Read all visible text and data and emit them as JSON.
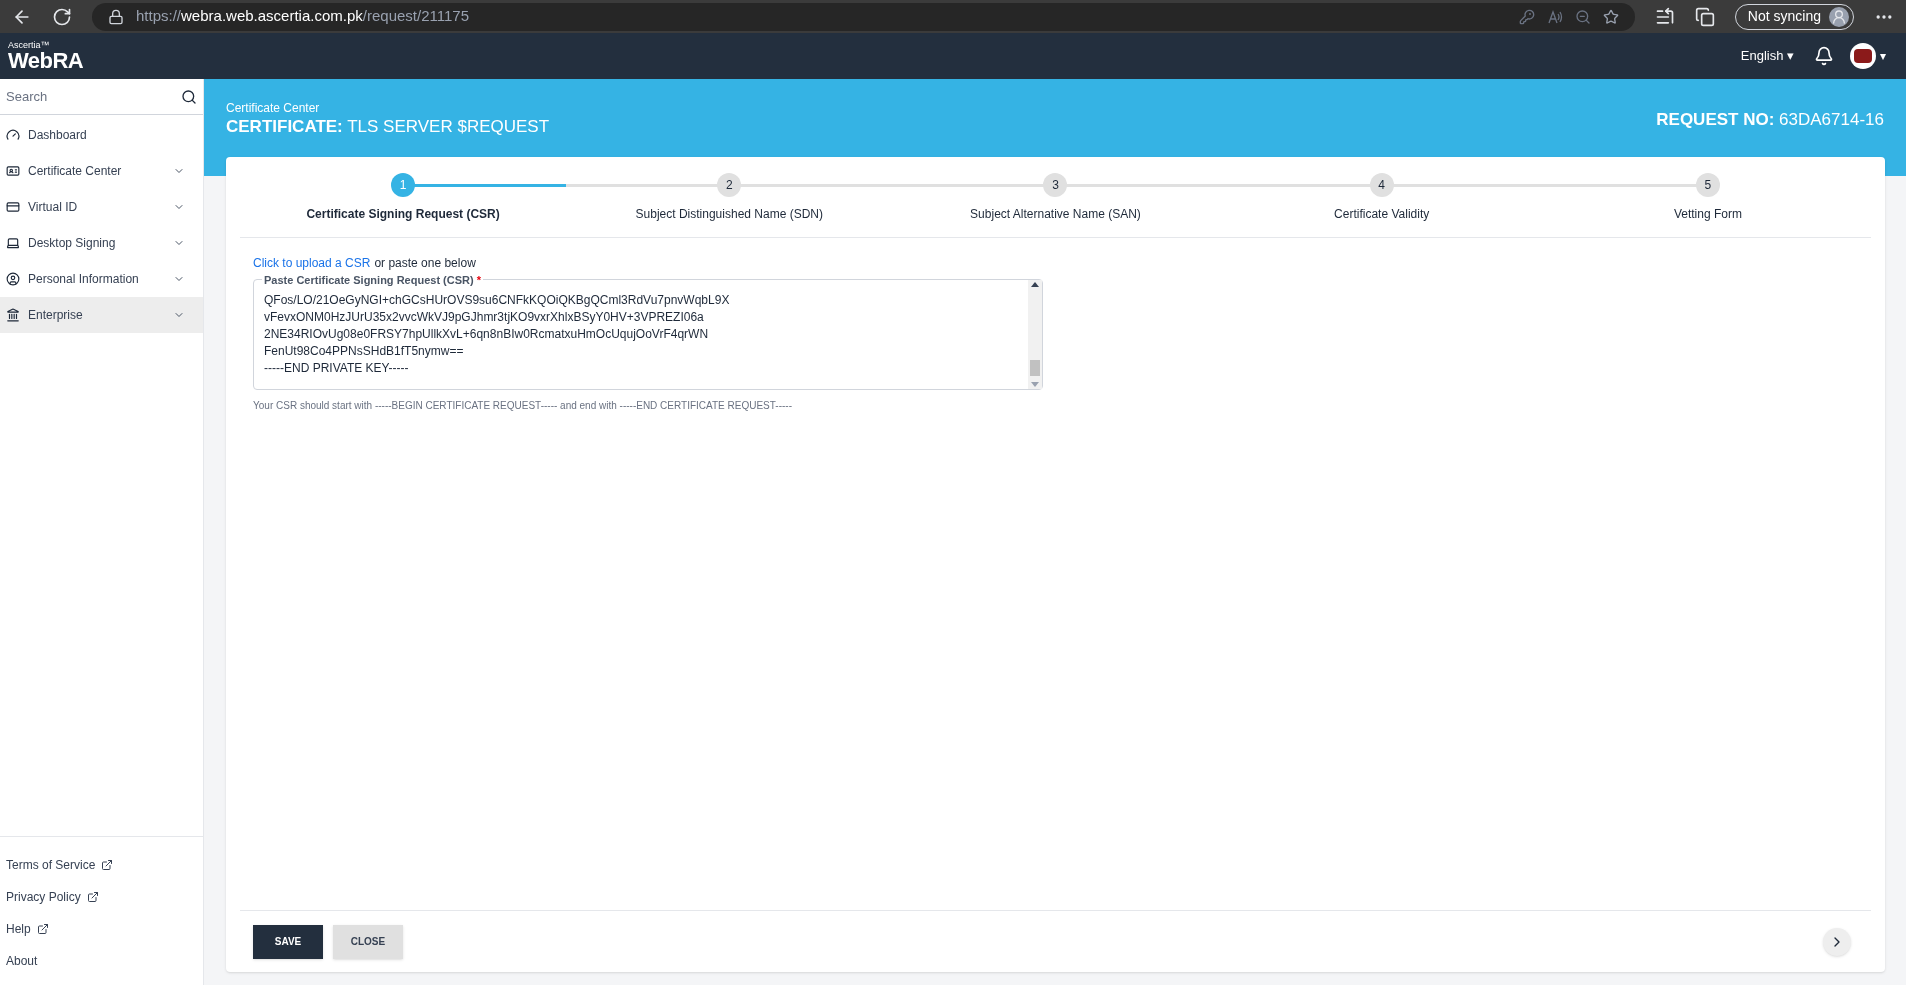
{
  "browser": {
    "url_scheme": "https://",
    "url_host": "webra.web.ascertia.com.pk",
    "url_path": "/request/211175",
    "sync_label": "Not syncing"
  },
  "app_header": {
    "brand_small": "Ascertia™",
    "brand": "WebRA",
    "language": "English ▾",
    "account_caret": "▾"
  },
  "sidebar": {
    "search": {
      "placeholder": "Search"
    },
    "items": [
      {
        "label": "Dashboard",
        "kind": "link",
        "selected": false
      },
      {
        "label": "Certificate Center",
        "kind": "group",
        "selected": false
      },
      {
        "label": "Virtual ID",
        "kind": "group",
        "selected": false
      },
      {
        "label": "Desktop Signing",
        "kind": "group",
        "selected": false
      },
      {
        "label": "Personal Information",
        "kind": "group",
        "selected": false
      },
      {
        "label": "Enterprise",
        "kind": "group",
        "selected": true
      }
    ],
    "footer_links": [
      {
        "label": "Terms of Service",
        "kind": "external"
      },
      {
        "label": "Privacy Policy",
        "kind": "external"
      },
      {
        "label": "Help",
        "kind": "external"
      },
      {
        "label": "About",
        "kind": "internal"
      }
    ]
  },
  "page_header": {
    "breadcrumb": "Certificate Center",
    "title_prefix": "CERTIFICATE:",
    "title": "TLS SERVER $REQUEST",
    "request_label": "REQUEST NO:",
    "request_no": "63DA6714-16"
  },
  "steps": [
    {
      "number": "1",
      "label": "Certificate Signing Request (CSR)",
      "selected": true
    },
    {
      "number": "2",
      "label": "Subject Distinguished Name (SDN)",
      "selected": false
    },
    {
      "number": "3",
      "label": "Subject Alternative Name (SAN)",
      "selected": false
    },
    {
      "number": "4",
      "label": "Certificate Validity",
      "selected": false
    },
    {
      "number": "5",
      "label": "Vetting Form",
      "selected": false
    }
  ],
  "csr": {
    "upload_link": "Click to upload a CSR",
    "upload_rest": "or paste one below",
    "field_label": "Paste Certificate Signing Request (CSR)",
    "required_mark": "*",
    "lines": [
      "QFos/LO/21OeGyNGI+chGCsHUrOVS9su6CNFkKQOiQKBgQCml3RdVu7pnvWqbL9X",
      "vFevxONM0HzJUrU35x2vvcWkVJ9pGJhmr3tjKO9vxrXhlxBSyY0HV+3VPREZI06a",
      "2NE34RIOvUg08e0FRSY7hpUllkXvL+6qn8nBIw0RcmatxuHmOcUqujOoVrF4qrWN",
      "FenUt98Co4PPNsSHdB1fT5nymw==",
      "-----END PRIVATE KEY-----"
    ],
    "hint": "Your CSR should start with -----BEGIN CERTIFICATE REQUEST----- and end with -----END CERTIFICATE REQUEST-----"
  },
  "actions": [
    {
      "label": "SAVE",
      "kind": "primary"
    },
    {
      "label": "CLOSE",
      "kind": "secondary"
    }
  ]
}
